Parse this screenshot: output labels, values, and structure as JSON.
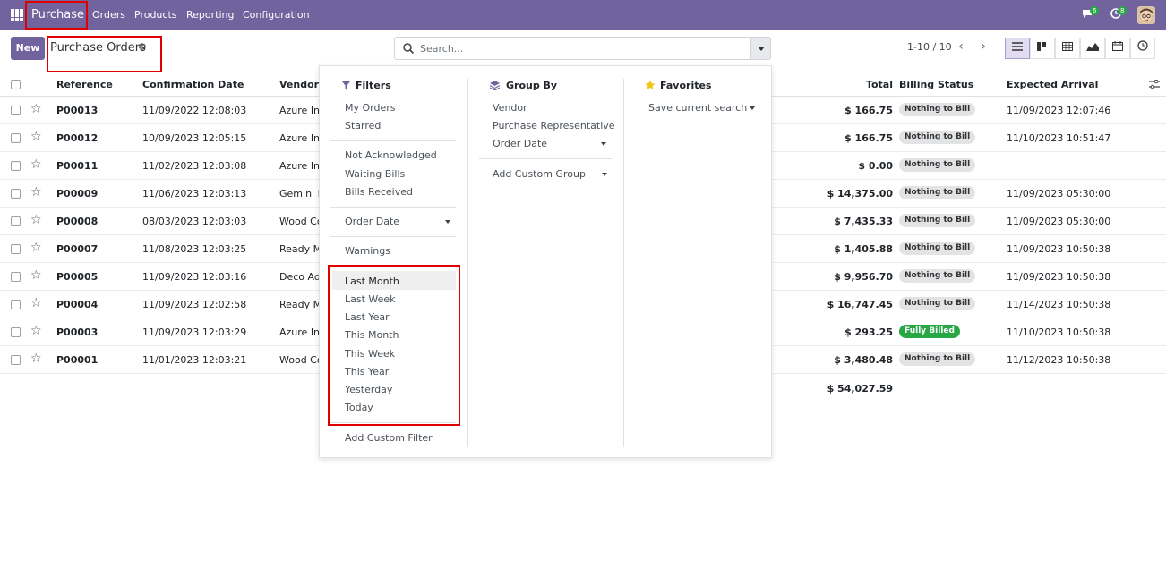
{
  "nav": {
    "app_name": "Purchase",
    "menu": [
      "Orders",
      "Products",
      "Reporting",
      "Configuration"
    ],
    "chat_count": "6",
    "activity_count": "8"
  },
  "control": {
    "new_label": "New",
    "title": "Purchase Orders",
    "search_placeholder": "Search...",
    "pager": "1-10 / 10"
  },
  "table": {
    "headers": [
      "Reference",
      "Confirmation Date",
      "Vendor",
      "Total",
      "Billing Status",
      "Expected Arrival"
    ],
    "rows": [
      {
        "ref": "P00013",
        "date": "11/09/2022 12:08:03",
        "vendor": "Azure Int",
        "total": "$ 166.75",
        "status": "Nothing to Bill",
        "arrival": "11/09/2023 12:07:46"
      },
      {
        "ref": "P00012",
        "date": "10/09/2023 12:05:15",
        "vendor": "Azure Int",
        "total": "$ 166.75",
        "status": "Nothing to Bill",
        "arrival": "11/10/2023 10:51:47"
      },
      {
        "ref": "P00011",
        "date": "11/02/2023 12:03:08",
        "vendor": "Azure Int",
        "total": "$ 0.00",
        "status": "Nothing to Bill",
        "arrival": ""
      },
      {
        "ref": "P00009",
        "date": "11/06/2023 12:03:13",
        "vendor": "Gemini Fu",
        "total": "$ 14,375.00",
        "status": "Nothing to Bill",
        "arrival": "11/09/2023 05:30:00"
      },
      {
        "ref": "P00008",
        "date": "08/03/2023 12:03:03",
        "vendor": "Wood Co",
        "total": "$ 7,435.33",
        "status": "Nothing to Bill",
        "arrival": "11/09/2023 05:30:00"
      },
      {
        "ref": "P00007",
        "date": "11/08/2023 12:03:25",
        "vendor": "Ready Ma",
        "total": "$ 1,405.88",
        "status": "Nothing to Bill",
        "arrival": "11/09/2023 10:50:38"
      },
      {
        "ref": "P00005",
        "date": "11/09/2023 12:03:16",
        "vendor": "Deco Add",
        "total": "$ 9,956.70",
        "status": "Nothing to Bill",
        "arrival": "11/09/2023 10:50:38"
      },
      {
        "ref": "P00004",
        "date": "11/09/2023 12:02:58",
        "vendor": "Ready Ma",
        "total": "$ 16,747.45",
        "status": "Nothing to Bill",
        "arrival": "11/14/2023 10:50:38"
      },
      {
        "ref": "P00003",
        "date": "11/09/2023 12:03:29",
        "vendor": "Azure Int",
        "total": "$ 293.25",
        "status": "Fully Billed",
        "arrival": "11/10/2023 10:50:38"
      },
      {
        "ref": "P00001",
        "date": "11/01/2023 12:03:21",
        "vendor": "Wood Co",
        "total": "$ 3,480.48",
        "status": "Nothing to Bill",
        "arrival": "11/12/2023 10:50:38"
      }
    ],
    "grand_total": "$ 54,027.59"
  },
  "dropdown": {
    "filters": {
      "title": "Filters",
      "group1": [
        "My Orders",
        "Starred"
      ],
      "group2": [
        "Not Acknowledged",
        "Waiting Bills",
        "Bills Received"
      ],
      "order_date": "Order Date",
      "warnings": "Warnings",
      "dates": [
        "Last Month",
        "Last Week",
        "Last Year",
        "This Month",
        "This Week",
        "This Year",
        "Yesterday",
        "Today"
      ],
      "add_custom": "Add Custom Filter"
    },
    "groupby": {
      "title": "Group By",
      "items": [
        "Vendor",
        "Purchase Representative"
      ],
      "order_date": "Order Date",
      "add_custom": "Add Custom Group"
    },
    "favorites": {
      "title": "Favorites",
      "save": "Save current search"
    }
  },
  "colors": {
    "brand": "#71639e",
    "highlight_border": "#e00000",
    "badge_green": "#28a745"
  }
}
